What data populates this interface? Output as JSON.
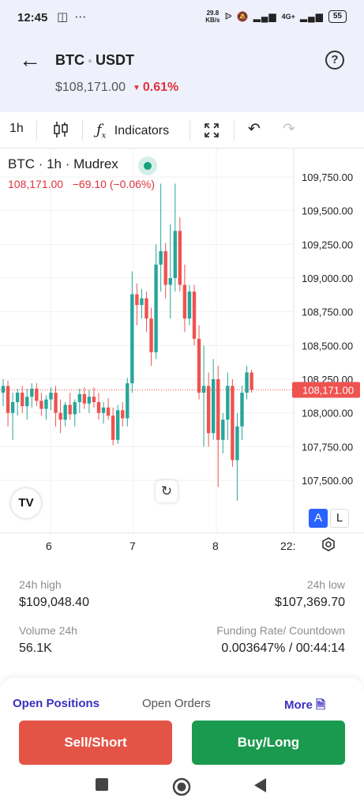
{
  "status_bar": {
    "time": "12:45",
    "net_speed_value": "29.8",
    "net_speed_unit": "KB/s",
    "network": "4G+",
    "battery": "55"
  },
  "header": {
    "base": "BTC",
    "quote": "USDT",
    "price": "$108,171.00",
    "change": "0.61%",
    "change_color": "#e0313f"
  },
  "toolbar": {
    "interval": "1h",
    "indicators_label": "Indicators"
  },
  "chart_legend": {
    "title": "BTC · 1h · Mudrex",
    "ohlc": "108,171.00   −69.10 (−0.06%)"
  },
  "chart_data": {
    "type": "candlestick",
    "title": "BTC · 1h · Mudrex",
    "y_ticks": [
      109750,
      109500,
      109250,
      109000,
      108750,
      108500,
      108250,
      108000,
      107750,
      107500
    ],
    "y_tick_labels": [
      "109,750.00",
      "109,500.00",
      "109,250.00",
      "109,000.00",
      "108,750.00",
      "108,500.00",
      "108,250.00",
      "108,000.00",
      "107,750.00",
      "107,500.00"
    ],
    "last_price": 108171,
    "last_price_label": "108,171.00",
    "x_ticks": [
      "6",
      "7",
      "8",
      "22:"
    ],
    "colors": {
      "up": "#26a69a",
      "down": "#ef5350"
    },
    "candles": [
      {
        "o": 108150,
        "h": 108250,
        "l": 108050,
        "c": 108200
      },
      {
        "o": 108200,
        "h": 108240,
        "l": 107900,
        "c": 108000
      },
      {
        "o": 108000,
        "h": 108150,
        "l": 107800,
        "c": 108080
      },
      {
        "o": 108080,
        "h": 108180,
        "l": 107980,
        "c": 108150
      },
      {
        "o": 108150,
        "h": 108200,
        "l": 108000,
        "c": 108050
      },
      {
        "o": 108050,
        "h": 108180,
        "l": 107950,
        "c": 108120
      },
      {
        "o": 108120,
        "h": 108220,
        "l": 108040,
        "c": 108180
      },
      {
        "o": 108180,
        "h": 108220,
        "l": 108050,
        "c": 108090
      },
      {
        "o": 108090,
        "h": 108150,
        "l": 107980,
        "c": 108030
      },
      {
        "o": 108030,
        "h": 108130,
        "l": 107950,
        "c": 108100
      },
      {
        "o": 108100,
        "h": 108190,
        "l": 108020,
        "c": 108150
      },
      {
        "o": 108150,
        "h": 108200,
        "l": 107900,
        "c": 108000
      },
      {
        "o": 108000,
        "h": 108100,
        "l": 107850,
        "c": 107950
      },
      {
        "o": 107950,
        "h": 108080,
        "l": 107900,
        "c": 108060
      },
      {
        "o": 108060,
        "h": 108150,
        "l": 107950,
        "c": 107990
      },
      {
        "o": 107990,
        "h": 108100,
        "l": 107900,
        "c": 108080
      },
      {
        "o": 108080,
        "h": 108180,
        "l": 108000,
        "c": 108140
      },
      {
        "o": 108140,
        "h": 108190,
        "l": 108030,
        "c": 108070
      },
      {
        "o": 108070,
        "h": 108170,
        "l": 108000,
        "c": 108120
      },
      {
        "o": 108120,
        "h": 108190,
        "l": 108040,
        "c": 108080
      },
      {
        "o": 108080,
        "h": 108150,
        "l": 107950,
        "c": 108000
      },
      {
        "o": 108000,
        "h": 108080,
        "l": 107920,
        "c": 108040
      },
      {
        "o": 108040,
        "h": 108110,
        "l": 107950,
        "c": 107980
      },
      {
        "o": 107980,
        "h": 108040,
        "l": 107760,
        "c": 107800
      },
      {
        "o": 107800,
        "h": 108060,
        "l": 107770,
        "c": 108020
      },
      {
        "o": 108020,
        "h": 108080,
        "l": 107900,
        "c": 107960
      },
      {
        "o": 107960,
        "h": 108260,
        "l": 107900,
        "c": 108220
      },
      {
        "o": 108220,
        "h": 109050,
        "l": 108150,
        "c": 108880
      },
      {
        "o": 108880,
        "h": 108960,
        "l": 108650,
        "c": 108800
      },
      {
        "o": 108800,
        "h": 108920,
        "l": 108700,
        "c": 108850
      },
      {
        "o": 108850,
        "h": 108900,
        "l": 108600,
        "c": 108700
      },
      {
        "o": 108700,
        "h": 108780,
        "l": 108350,
        "c": 108450
      },
      {
        "o": 108450,
        "h": 109250,
        "l": 108400,
        "c": 109100
      },
      {
        "o": 109100,
        "h": 109700,
        "l": 108900,
        "c": 109200
      },
      {
        "o": 109200,
        "h": 109260,
        "l": 108850,
        "c": 108950
      },
      {
        "o": 108950,
        "h": 109400,
        "l": 108700,
        "c": 109000
      },
      {
        "o": 109000,
        "h": 109700,
        "l": 108900,
        "c": 109350
      },
      {
        "o": 109350,
        "h": 109450,
        "l": 108900,
        "c": 108950
      },
      {
        "o": 108950,
        "h": 109100,
        "l": 108600,
        "c": 108700
      },
      {
        "o": 108700,
        "h": 108950,
        "l": 108650,
        "c": 108900
      },
      {
        "o": 108900,
        "h": 108950,
        "l": 108500,
        "c": 108550
      },
      {
        "o": 108550,
        "h": 108650,
        "l": 108100,
        "c": 108150
      },
      {
        "o": 108150,
        "h": 108500,
        "l": 107750,
        "c": 108200
      },
      {
        "o": 108200,
        "h": 108300,
        "l": 107750,
        "c": 107850
      },
      {
        "o": 107850,
        "h": 108400,
        "l": 107800,
        "c": 108250
      },
      {
        "o": 108250,
        "h": 108350,
        "l": 107450,
        "c": 107800
      },
      {
        "o": 107800,
        "h": 108000,
        "l": 107700,
        "c": 107950
      },
      {
        "o": 107950,
        "h": 108300,
        "l": 107800,
        "c": 108200
      },
      {
        "o": 108200,
        "h": 108250,
        "l": 107600,
        "c": 107650
      },
      {
        "o": 107650,
        "h": 108000,
        "l": 107350,
        "c": 107900
      },
      {
        "o": 107900,
        "h": 108200,
        "l": 107800,
        "c": 108150
      },
      {
        "o": 108150,
        "h": 108350,
        "l": 108100,
        "c": 108300
      },
      {
        "o": 108300,
        "h": 108320,
        "l": 108150,
        "c": 108171
      }
    ]
  },
  "chart_controls": {
    "scale_auto": "A",
    "scale_log": "L"
  },
  "stats": {
    "high_label": "24h high",
    "high_value": "$109,048.40",
    "low_label": "24h low",
    "low_value": "$107,369.70",
    "volume_label": "Volume 24h",
    "volume_value": "56.1K",
    "funding_label": "Funding Rate/ Countdown",
    "funding_value": "0.003647% / 00:44:14"
  },
  "orders": {
    "tab1": "Open Positions",
    "tab2": "Open Orders",
    "more": "More"
  },
  "actions": {
    "sell": "Sell/Short",
    "buy": "Buy/Long"
  }
}
